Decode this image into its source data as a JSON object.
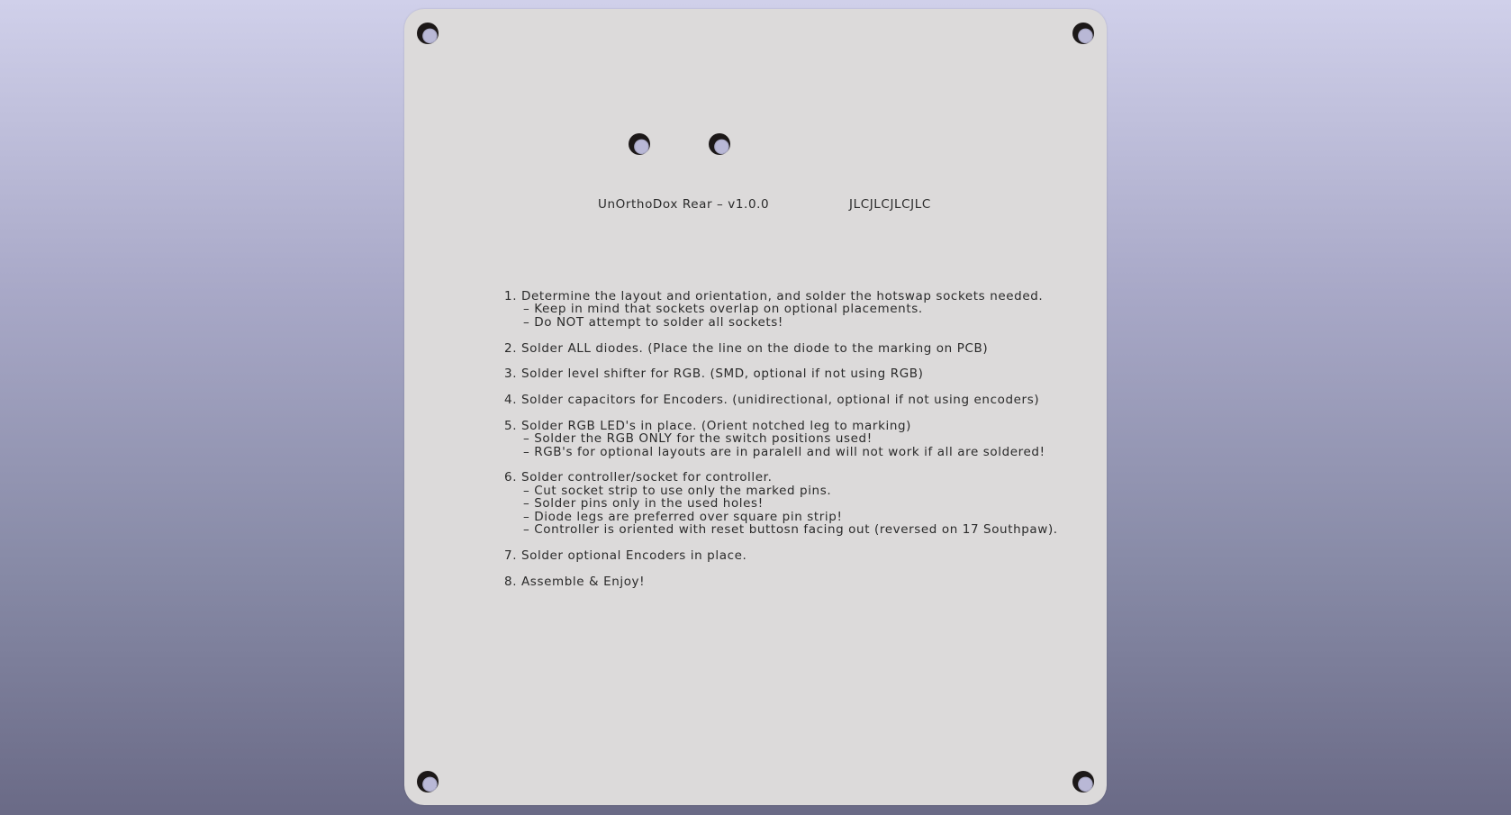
{
  "board": {
    "title": "UnOrthoDox Rear – v1.0.0",
    "order_number_placeholder": "JLCJLCJLCJLC"
  },
  "instructions": [
    {
      "text": "1. Determine the layout and orientation, and solder the hotswap sockets needed.",
      "subs": [
        "– Keep in mind that sockets overlap on optional placements.",
        "– Do NOT attempt to solder all sockets!"
      ]
    },
    {
      "text": "2. Solder ALL diodes. (Place the line on the diode to the marking on PCB)",
      "subs": []
    },
    {
      "text": "3. Solder level shifter for RGB. (SMD, optional if not using RGB)",
      "subs": []
    },
    {
      "text": "4. Solder capacitors for Encoders. (unidirectional, optional if not using encoders)",
      "subs": []
    },
    {
      "text": "5. Solder RGB LED's in place. (Orient notched leg to marking)",
      "subs": [
        "– Solder the RGB ONLY for the switch positions used!",
        "– RGB's for optional layouts are in paralell and will not work if all are soldered!"
      ]
    },
    {
      "text": "6. Solder controller/socket for controller.",
      "subs": [
        "– Cut socket strip to use only the marked pins.",
        "– Solder pins only in the used holes!",
        "– Diode legs are preferred over square pin strip!",
        "– Controller is oriented with reset buttosn facing out (reversed on 17 Southpaw)."
      ]
    },
    {
      "text": "7. Solder optional Encoders in place.",
      "subs": []
    },
    {
      "text": "8. Assemble & Enjoy!",
      "subs": []
    }
  ]
}
